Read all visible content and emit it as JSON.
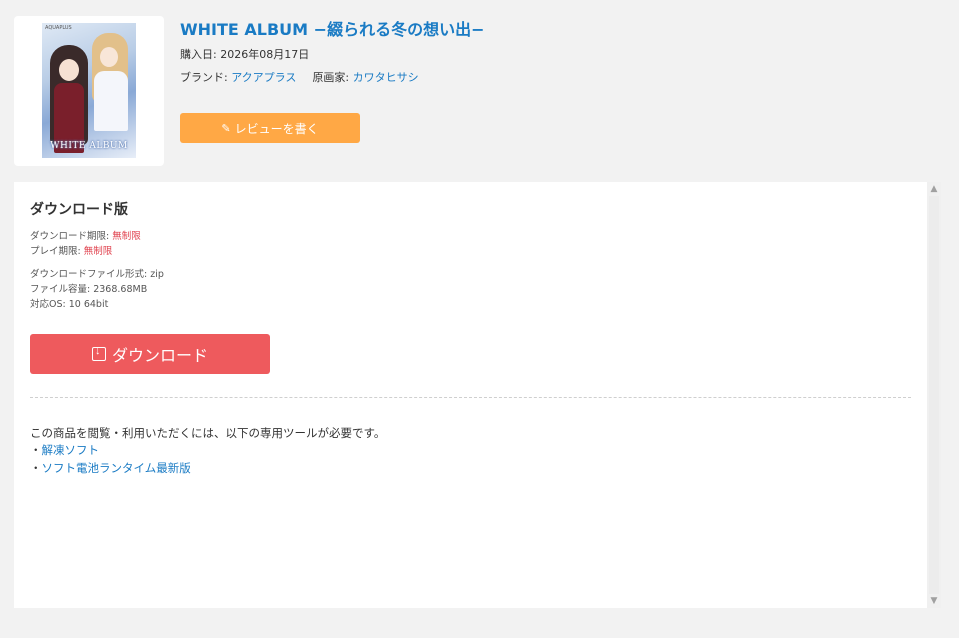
{
  "product": {
    "title": "WHITE ALBUM −綴られる冬の想い出−",
    "cover": {
      "publisher_mark": "AQUAPLUS",
      "logo_text": "WHITE ALBUM"
    },
    "purchase_label": "購入日: ",
    "purchase_date": "2026年08月17日",
    "brand_label": "ブランド: ",
    "brand": "アクアプラス",
    "artist_label": "原画家: ",
    "artist": "カワタヒサシ",
    "review_button": "レビューを書く",
    "review_icon": "pencil-icon"
  },
  "download": {
    "section_title": "ダウンロード版",
    "download_limit_label": "ダウンロード期限: ",
    "download_limit": "無制限",
    "play_limit_label": "プレイ期限: ",
    "play_limit": "無制限",
    "file_format": "ダウンロードファイル形式: zip",
    "file_size": "ファイル容量: 2368.68MB",
    "os": "対応OS: 10 64bit",
    "download_button": "ダウンロード",
    "download_icon": "download-icon",
    "limit_color": "#e0424e",
    "button_color": "#ee5a5d"
  },
  "tools": {
    "notice": "この商品を閲覧・利用いただくには、以下の専用ツールが必要です。",
    "bullet": "・",
    "items": [
      {
        "label": "解凍ソフト"
      },
      {
        "label": "ソフト電池ランタイム最新版"
      }
    ]
  },
  "colors": {
    "accent": "#1a7bc4",
    "review_button": "#ffa845",
    "background": "#f2f2f2"
  }
}
